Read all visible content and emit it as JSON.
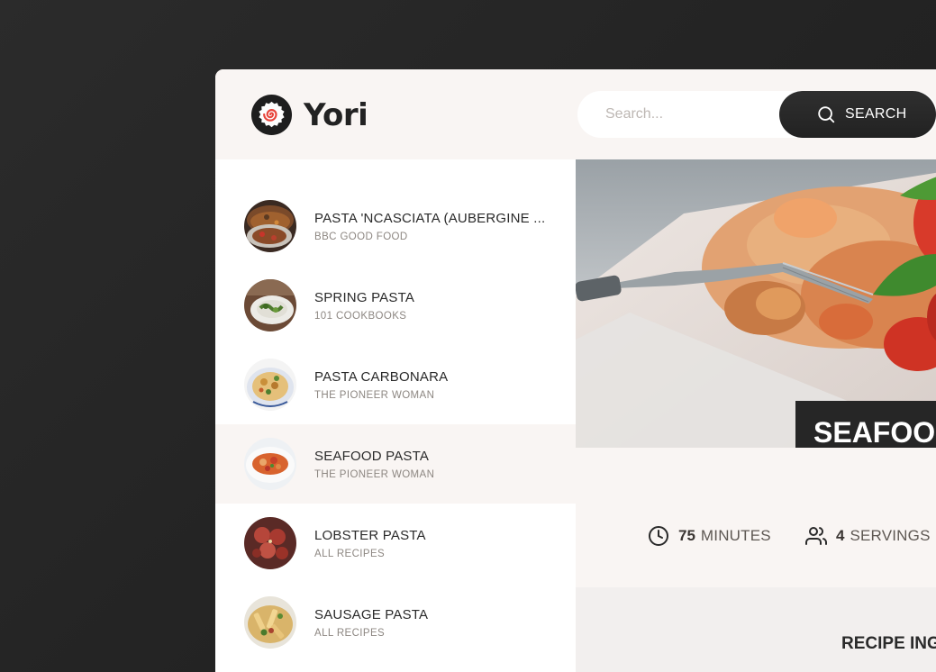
{
  "app": {
    "logo_text": "Yori"
  },
  "search": {
    "placeholder": "Search...",
    "button_label": "SEARCH",
    "button_icon": "search-icon"
  },
  "results": [
    {
      "title": "PASTA 'NCASCIATA (AUBERGINE ...",
      "publisher": "BBC GOOD FOOD",
      "active": false
    },
    {
      "title": "SPRING PASTA",
      "publisher": "101 COOKBOOKS",
      "active": false
    },
    {
      "title": "PASTA CARBONARA",
      "publisher": "THE PIONEER WOMAN",
      "active": false
    },
    {
      "title": "SEAFOOD PASTA",
      "publisher": "THE PIONEER WOMAN",
      "active": true
    },
    {
      "title": "LOBSTER PASTA",
      "publisher": "ALL RECIPES",
      "active": false
    },
    {
      "title": "SAUSAGE PASTA",
      "publisher": "ALL RECIPES",
      "active": false
    }
  ],
  "recipe": {
    "title": "SEAFOOD PASTA",
    "cooking_time": {
      "value": "75",
      "unit": "MINUTES",
      "icon": "clock-icon"
    },
    "servings": {
      "value": "4",
      "unit": "SERVINGS",
      "icon": "users-icon"
    },
    "ingredients_heading": "RECIPE INGREDIENTS"
  },
  "colors": {
    "background": "#2b2b2b",
    "app_background": "#f9f5f3",
    "dark": "#262626",
    "text": "#2a2a2a",
    "muted": "#8d8782"
  }
}
